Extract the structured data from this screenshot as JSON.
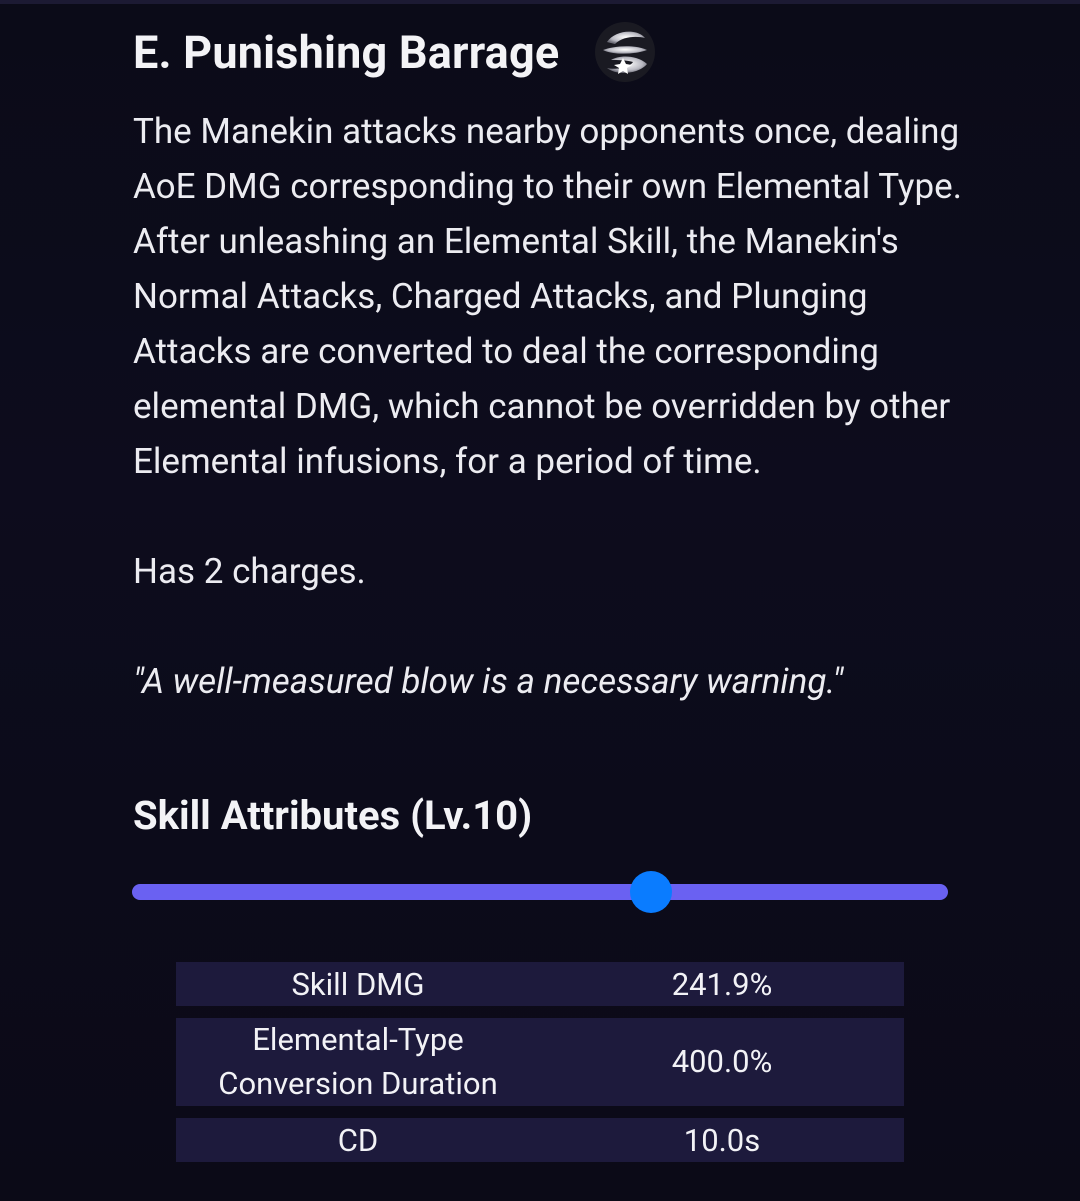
{
  "skill": {
    "title": "E. Punishing Barrage",
    "icon": "elemental-skill-icon"
  },
  "description": {
    "main": "The Manekin attacks nearby opponents once, dealing AoE DMG corresponding to their own Elemental Type. After unleashing an Elemental Skill, the Manekin's Normal Attacks, Charged Attacks, and Plunging Attacks are converted to deal the corresponding elemental DMG, which cannot be overridden by other Elemental infusions, for a period of time.",
    "charges": "Has 2 charges.",
    "quote": "\"A well-measured blow is a necessary warning.\""
  },
  "attributes": {
    "title": "Skill Attributes (Lv.10)",
    "level_fraction": 0.636,
    "rows": [
      {
        "label": "Skill DMG",
        "value": "241.9%"
      },
      {
        "label": "Elemental-Type Conversion Duration",
        "value": "400.0%"
      },
      {
        "label": "CD",
        "value": "10.0s"
      }
    ]
  },
  "colors": {
    "background": "#0b0b18",
    "slider_track": "#6a61f2",
    "slider_thumb": "#0a7cff",
    "table_row": "#1d1a3c"
  }
}
